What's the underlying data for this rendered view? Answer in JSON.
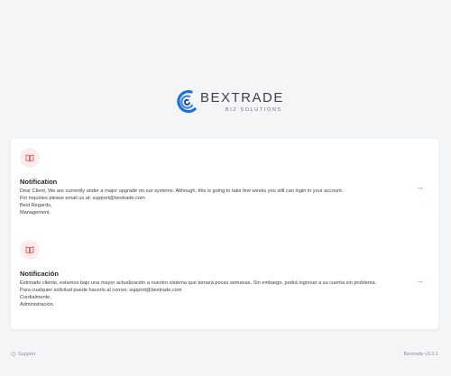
{
  "brand": {
    "name": "BEXTRADE",
    "subtitle": "BIZ SOLUTIONS",
    "color": "#1e6fd9"
  },
  "notices": [
    {
      "title": "Notification",
      "lines": [
        "Dear Client, We are currently under a major upgrade on our systems. Although, this is going to take few weeks you still can login in your account.",
        "For inquiries please email us at: support@bextrade.com",
        "Best Regards,",
        "Management."
      ]
    },
    {
      "title": "Notificación",
      "lines": [
        "Estimado cliente, estamos bajo una mayor actualización a nuestro sistema que tomará pocas semanas. Sin embargo, podrá ingresar a su cuenta sin problema.",
        "Para cualquier solicitud puede hacerlo al correo: support@bextrade.com",
        "Cordialmente,",
        "Administración."
      ]
    }
  ],
  "footer": {
    "support": "Support",
    "version": "Bextrade v3.0.1"
  },
  "colors": {
    "accent": "#e05a5a",
    "icon_bg": "#fdecec",
    "background": "#f4f5f7"
  }
}
